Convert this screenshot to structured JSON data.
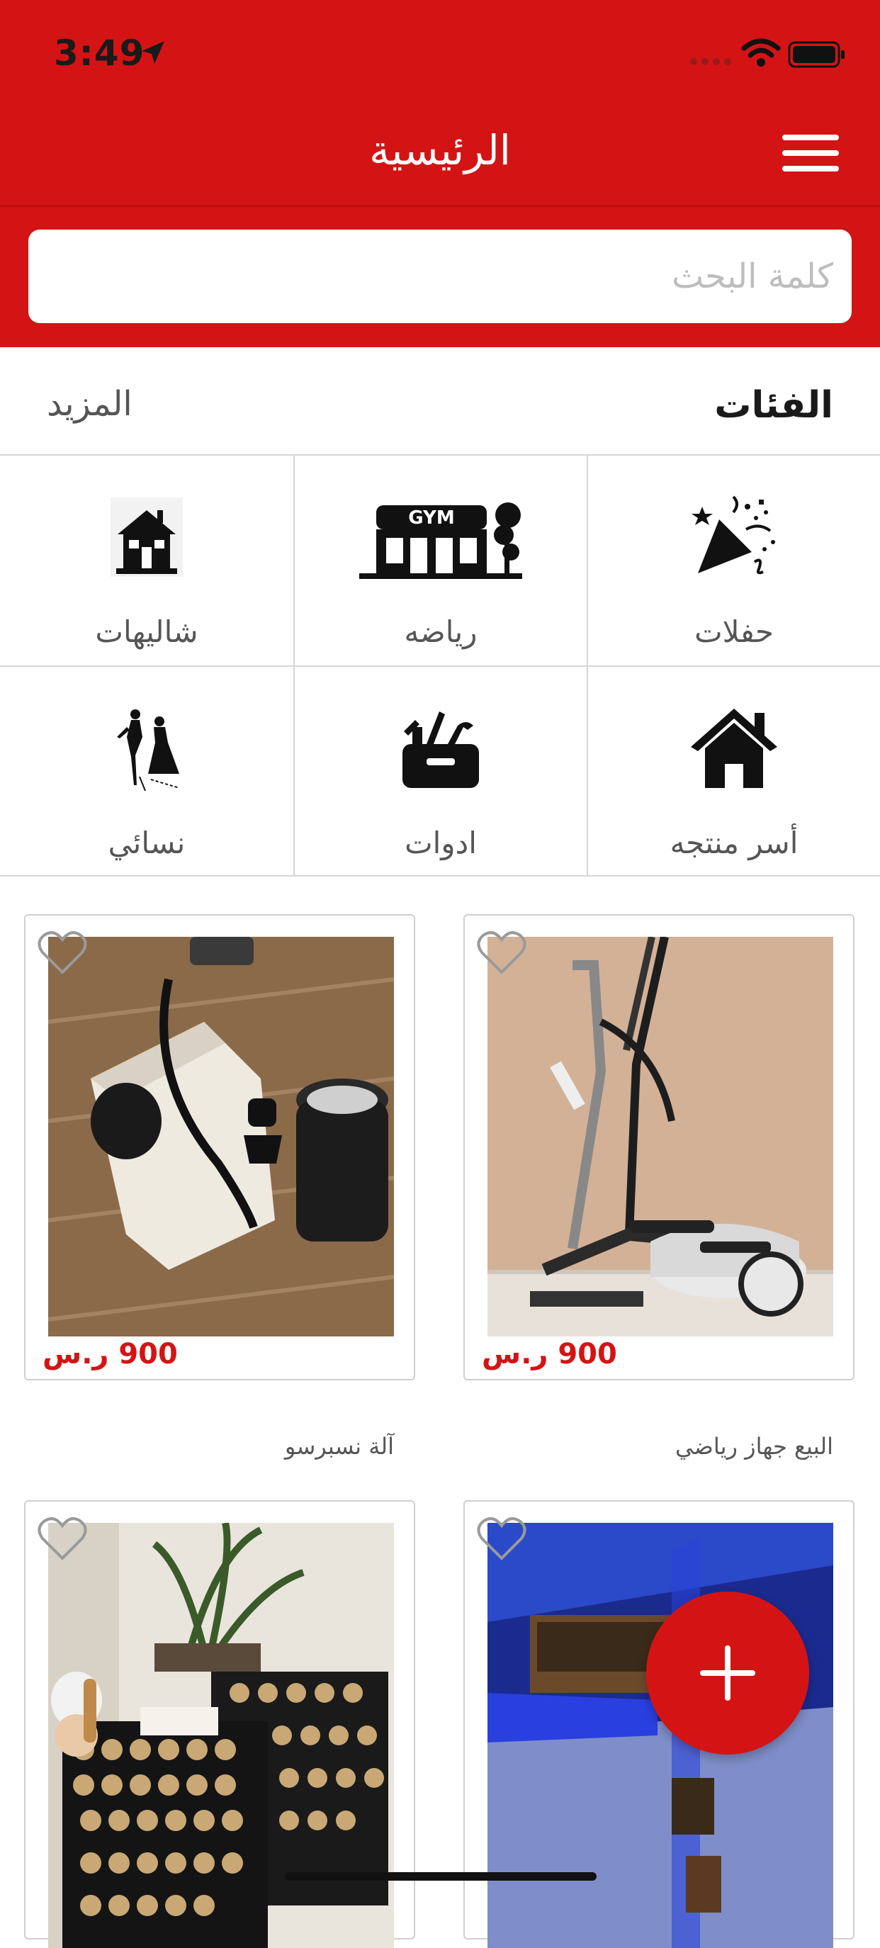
{
  "status_bar": {
    "time": "3:49"
  },
  "header": {
    "title": "الرئيسية"
  },
  "search": {
    "placeholder": "كلمة البحث"
  },
  "categories": {
    "title": "الفئات",
    "more_label": "المزيد",
    "items": [
      {
        "label": "حفلات",
        "icon": "party-popper-icon"
      },
      {
        "label": "رياضه",
        "icon": "gym-icon"
      },
      {
        "label": "شاليهات",
        "icon": "house-icon"
      },
      {
        "label": "أسر منتجه",
        "icon": "home-icon"
      },
      {
        "label": "ادوات",
        "icon": "toolbox-icon"
      },
      {
        "label": "نسائي",
        "icon": "women-fashion-icon"
      }
    ]
  },
  "products": [
    {
      "name": "البيع جهاز رياضي",
      "price": "900 ر.س"
    },
    {
      "name": "آلة نسبرسو",
      "price": "900 ر.س"
    },
    {
      "name": "",
      "price": ""
    },
    {
      "name": "",
      "price": ""
    }
  ],
  "colors": {
    "brand_red": "#d41414",
    "price_red": "#d41414"
  }
}
